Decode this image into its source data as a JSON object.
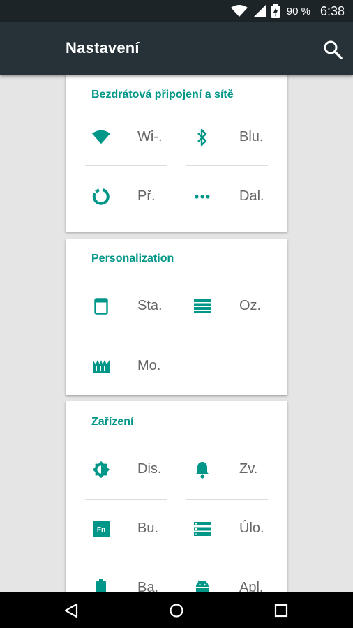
{
  "status_bar": {
    "battery_percent": "90 %",
    "time": "6:38",
    "icons": [
      "wifi-signal-icon",
      "cell-signal-icon",
      "battery-charging-icon"
    ]
  },
  "app_bar": {
    "title": "Nastavení",
    "search_icon": "search-icon"
  },
  "colors": {
    "accent": "#009688",
    "app_bar": "#263238",
    "status_bar": "#1c2428",
    "background": "#e5e5e5"
  },
  "sections": [
    {
      "title": "Bezdrátová připojení a sítě",
      "items": [
        {
          "label": "Wi-.",
          "icon": "wifi-icon"
        },
        {
          "label": "Blu.",
          "icon": "bluetooth-icon"
        },
        {
          "label": "Př.",
          "icon": "data-usage-icon"
        },
        {
          "label": "Dal.",
          "icon": "more-icon"
        }
      ]
    },
    {
      "title": "Personalization",
      "items": [
        {
          "label": "Sta.",
          "icon": "status-bar-icon"
        },
        {
          "label": "Oz.",
          "icon": "notifications-icon"
        },
        {
          "label": "Mo.",
          "icon": "theme-icon"
        }
      ]
    },
    {
      "title": "Zařízení",
      "items": [
        {
          "label": "Dis.",
          "icon": "display-brightness-icon"
        },
        {
          "label": "Zv.",
          "icon": "sound-bell-icon"
        },
        {
          "label": "Bu.",
          "icon": "buttons-fn-icon"
        },
        {
          "label": "Úlo.",
          "icon": "storage-icon"
        },
        {
          "label": "Ba.",
          "icon": "battery-icon"
        },
        {
          "label": "Apl.",
          "icon": "android-apps-icon"
        }
      ]
    }
  ],
  "nav_bar": {
    "icons": [
      "back-icon",
      "home-icon",
      "recents-icon"
    ]
  }
}
